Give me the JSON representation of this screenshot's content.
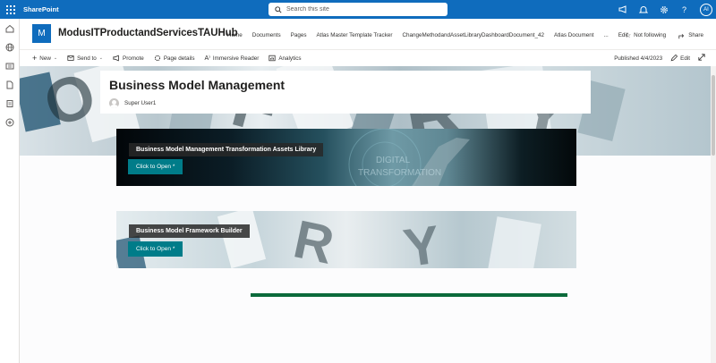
{
  "suite": {
    "brand": "SharePoint",
    "search_placeholder": "Search this site",
    "avatar_initials": "AI"
  },
  "site": {
    "logo_letter": "M",
    "title": "ModusITProductandServicesTAUHub",
    "nav": [
      "Home",
      "Documents",
      "Pages",
      "Atlas Master Template Tracker",
      "ChangeMethodandAssetLibraryDashboardDocument_42",
      "Atlas Document",
      "...",
      "Edit"
    ],
    "follow_label": "Not following",
    "share_label": "Share"
  },
  "commandbar": {
    "new_label": "New",
    "sendto_label": "Send to",
    "promote_label": "Promote",
    "pagedetails_label": "Page details",
    "immersive_label": "Immersive Reader",
    "analytics_label": "Analytics",
    "published_label": "Published 4/4/2023",
    "edit_label": "Edit"
  },
  "page": {
    "title": "Business Model Management",
    "author": "Super User1"
  },
  "banners": [
    {
      "title": "Business Model Management Transformation Assets Library",
      "button": "Click to Open *"
    },
    {
      "title": "Business Model Framework Builder",
      "button": "Click to Open *"
    }
  ],
  "colors": {
    "suite_blue": "#0f6cbd",
    "button_teal": "#007c89",
    "strip_green": "#0b6a3b"
  }
}
